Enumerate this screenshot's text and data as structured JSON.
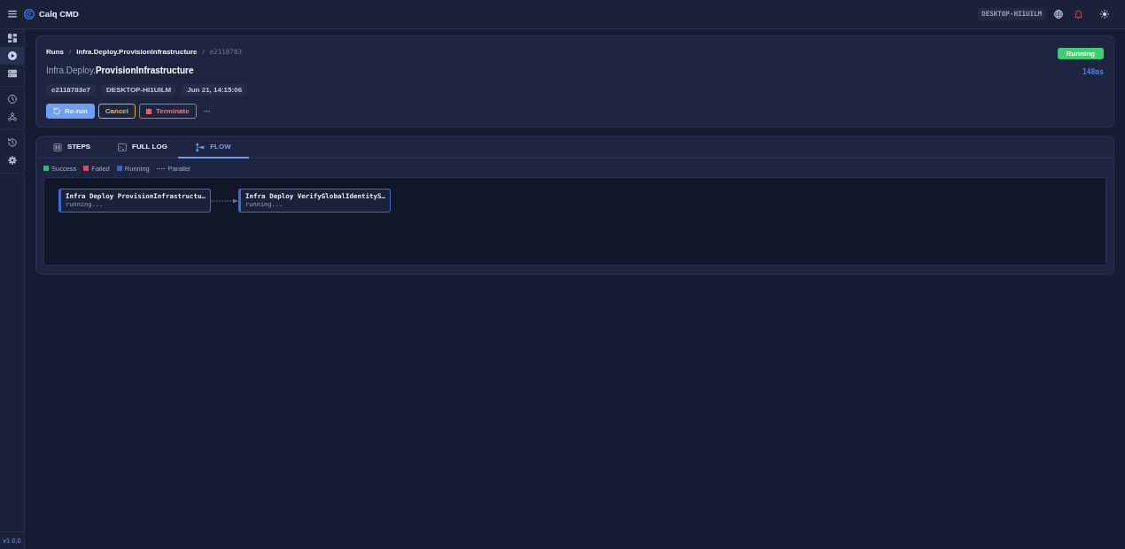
{
  "header": {
    "title": "Calq CMD",
    "hostname": "DESKTOP-HI1UILM"
  },
  "sidebar": {
    "groups": [
      {
        "items": [
          {
            "kind": "dashboard",
            "selected": false
          },
          {
            "kind": "play",
            "selected": true
          },
          {
            "kind": "server",
            "selected": false
          }
        ]
      },
      {
        "items": [
          {
            "kind": "clock",
            "selected": false
          },
          {
            "kind": "webhook",
            "selected": false
          }
        ]
      },
      {
        "items": [
          {
            "kind": "history",
            "selected": false
          },
          {
            "kind": "gear",
            "selected": false
          }
        ]
      }
    ],
    "version": "v1.0.0"
  },
  "run": {
    "breadcrumb": [
      {
        "kind": "link",
        "text": "Runs"
      },
      {
        "kind": "separator",
        "text": "/"
      },
      {
        "kind": "link",
        "text": "Infra.Deploy.ProvisionInfrastructure"
      },
      {
        "kind": "separator",
        "text": "/"
      },
      {
        "kind": "current",
        "text": "e2118783"
      }
    ],
    "title": "Infra.Deploy.**ProvisionInfrastructure**",
    "meta": [
      "e2118783e7",
      "DESKTOP-HI1UILM",
      "Jun 21, 14:15:06"
    ],
    "actions": [
      {
        "kind": "rerun",
        "label": "Re-run"
      },
      {
        "kind": "cancel",
        "label": "Cancel"
      },
      {
        "kind": "terminate",
        "label": "Terminate"
      },
      {
        "kind": "more",
        "label": "···"
      }
    ],
    "status": {
      "kind": "running",
      "label": "Running"
    },
    "duration": "148ms"
  },
  "tabs": [
    {
      "kind": "steps",
      "label": "STEPS",
      "selected": false
    },
    {
      "kind": "log",
      "label": "FULL LOG",
      "selected": false
    },
    {
      "kind": "flow",
      "label": "FLOW",
      "selected": true
    }
  ],
  "flow": {
    "legend": [
      {
        "kind": "swatch",
        "label": "Success",
        "color": "#22c55e"
      },
      {
        "kind": "swatch",
        "label": "Failed",
        "color": "#f0425a"
      },
      {
        "kind": "swatch",
        "label": "Running",
        "color": "#3b63c4"
      },
      {
        "kind": "dashed",
        "label": "Parallel"
      }
    ],
    "nodes": [
      {
        "kind": "running",
        "title": "Infra Deploy ProvisionInfrastructu…",
        "status": "running..."
      },
      {
        "kind": "running",
        "title": "Infra Deploy VerifyGlobalIdentityS…",
        "status": "running..."
      }
    ]
  }
}
